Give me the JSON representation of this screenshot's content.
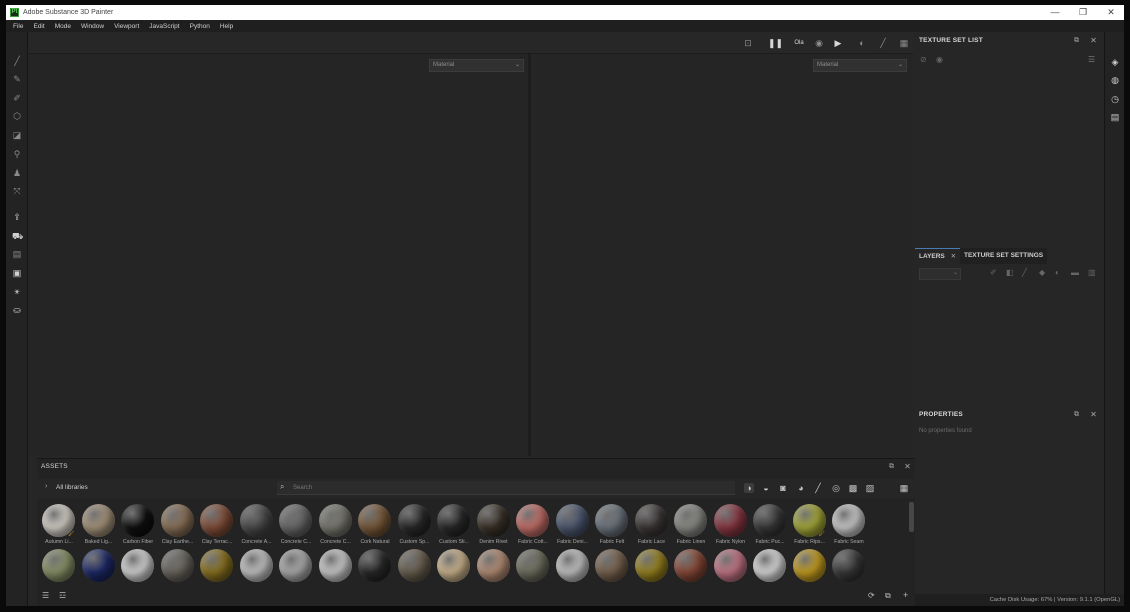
{
  "window": {
    "title": "Adobe Substance 3D Painter",
    "minimize": "—",
    "restore": "❐",
    "close": "✕"
  },
  "menu": [
    "File",
    "Edit",
    "Mode",
    "Window",
    "Viewport",
    "JavaScript",
    "Python",
    "Help"
  ],
  "viewport": {
    "left_dropdown": "Material",
    "right_dropdown": "Material",
    "camera_label": "Ola"
  },
  "texture_set_list": {
    "title": "TEXTURE SET LIST"
  },
  "layers": {
    "tab_layers": "LAYERS",
    "tab_texture_set_settings": "TEXTURE SET SETTINGS"
  },
  "properties": {
    "title": "PROPERTIES",
    "empty_message": "No properties found"
  },
  "assets": {
    "title": "ASSETS",
    "breadcrumb": "All libraries",
    "search_placeholder": "Search",
    "row1": [
      {
        "label": "Autumn Li...",
        "color": "#d9d4cc",
        "badge": true
      },
      {
        "label": "Baked Lig...",
        "color": "#a8967c",
        "badge": false
      },
      {
        "label": "Carbon Fiber",
        "color": "#101010",
        "badge": false
      },
      {
        "label": "Clay Earthe...",
        "color": "#8c7258",
        "badge": false
      },
      {
        "label": "Clay Terrac...",
        "color": "#85503a",
        "badge": false
      },
      {
        "label": "Concrete A...",
        "color": "#4c4c4c",
        "badge": false
      },
      {
        "label": "Concrete C...",
        "color": "#6b6b6b",
        "badge": false
      },
      {
        "label": "Concrete C...",
        "color": "#7a7a70",
        "badge": false
      },
      {
        "label": "Cork Natural",
        "color": "#7a5a3a",
        "badge": false
      },
      {
        "label": "Custom Sp...",
        "color": "#2a2a2a",
        "badge": false
      },
      {
        "label": "Custom Sti...",
        "color": "#2a2a2a",
        "badge": false
      },
      {
        "label": "Denim Rivet",
        "color": "#3a3328",
        "badge": false
      },
      {
        "label": "Fabric Cott...",
        "color": "#c8706a",
        "badge": false
      },
      {
        "label": "Fabric Deni...",
        "color": "#4e5a72",
        "badge": false
      },
      {
        "label": "Fabric Felt",
        "color": "#6e7680",
        "badge": false
      },
      {
        "label": "Fabric Lace",
        "color": "#3e3838",
        "badge": false
      },
      {
        "label": "Fabric Linen",
        "color": "#8c8c88",
        "badge": false
      },
      {
        "label": "Fabric Nylon",
        "color": "#8c3844",
        "badge": false
      },
      {
        "label": "Fabric Puc...",
        "color": "#3a3a3a",
        "badge": false
      },
      {
        "label": "Fabric Rips...",
        "color": "#a8ac38",
        "badge": true
      },
      {
        "label": "Fabric Seam",
        "color": "#cfcfcf",
        "badge": false
      }
    ],
    "row2": [
      {
        "color": "#8a9468"
      },
      {
        "color": "#1e2a6a"
      },
      {
        "color": "#d8d8d8"
      },
      {
        "color": "#6c6860"
      },
      {
        "color": "#8c7420"
      },
      {
        "color": "#c8c8c8"
      },
      {
        "color": "#b0b0b0"
      },
      {
        "color": "#d0d0d0"
      },
      {
        "color": "#2a2a2a"
      },
      {
        "color": "#6a6050"
      },
      {
        "color": "#d0b890"
      },
      {
        "color": "#b89078"
      },
      {
        "color": "#707060"
      },
      {
        "color": "#c8c8c8"
      },
      {
        "color": "#7a6450"
      },
      {
        "color": "#9a8420"
      },
      {
        "color": "#8a4a38"
      },
      {
        "color": "#c87888"
      },
      {
        "color": "#dedede"
      },
      {
        "color": "#c8a020"
      },
      {
        "color": "#3a3a3a"
      }
    ]
  },
  "status": {
    "text": "Cache Disk Usage:   67% | Version: 9.1.1 (OpenGL)"
  }
}
